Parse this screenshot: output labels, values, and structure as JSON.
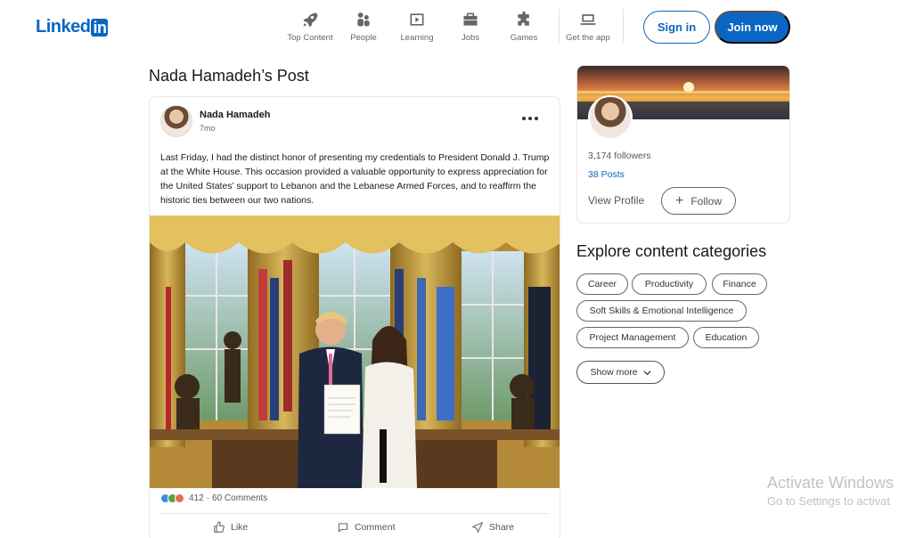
{
  "header": {
    "logo": "Linked",
    "logo_in": "in",
    "nav": [
      {
        "label": "Top Content",
        "icon": "rocket-icon"
      },
      {
        "label": "People",
        "icon": "people-icon"
      },
      {
        "label": "Learning",
        "icon": "video-icon"
      },
      {
        "label": "Jobs",
        "icon": "briefcase-icon"
      },
      {
        "label": "Games",
        "icon": "puzzle-icon"
      },
      {
        "label": "Get the app",
        "icon": "laptop-icon"
      }
    ],
    "signin_label": "Sign in",
    "join_label": "Join now"
  },
  "post": {
    "page_title": "Nada Hamadeh’s Post",
    "author": "Nada Hamadeh",
    "time": "7mo",
    "text": "Last Friday, I had the distinct honor of presenting my credentials to President Donald J. Trump at the White House. This occasion provided a valuable opportunity to express appreciation for the United States’ support to Lebanon and the Lebanese Armed Forces, and to reaffirm the historic ties between our two nations.",
    "reaction_count": "412",
    "comments": "60 Comments",
    "actions": {
      "like": "Like",
      "comment": "Comment",
      "share": "Share"
    }
  },
  "profile": {
    "followers": "3,174 followers",
    "posts": "38 Posts",
    "view_profile": "View Profile",
    "follow": "Follow"
  },
  "explore": {
    "title": "Explore content categories",
    "chips": [
      "Career",
      "Productivity",
      "Finance",
      "Soft Skills & Emotional Intelligence",
      "Project Management",
      "Education"
    ],
    "show_more": "Show more"
  },
  "watermark": {
    "line1": "Activate Windows",
    "line2": "Go to Settings to activat"
  },
  "colors": {
    "brand": "#0a66c2",
    "text_secondary": "#666666",
    "border": "#e6e6e6"
  }
}
